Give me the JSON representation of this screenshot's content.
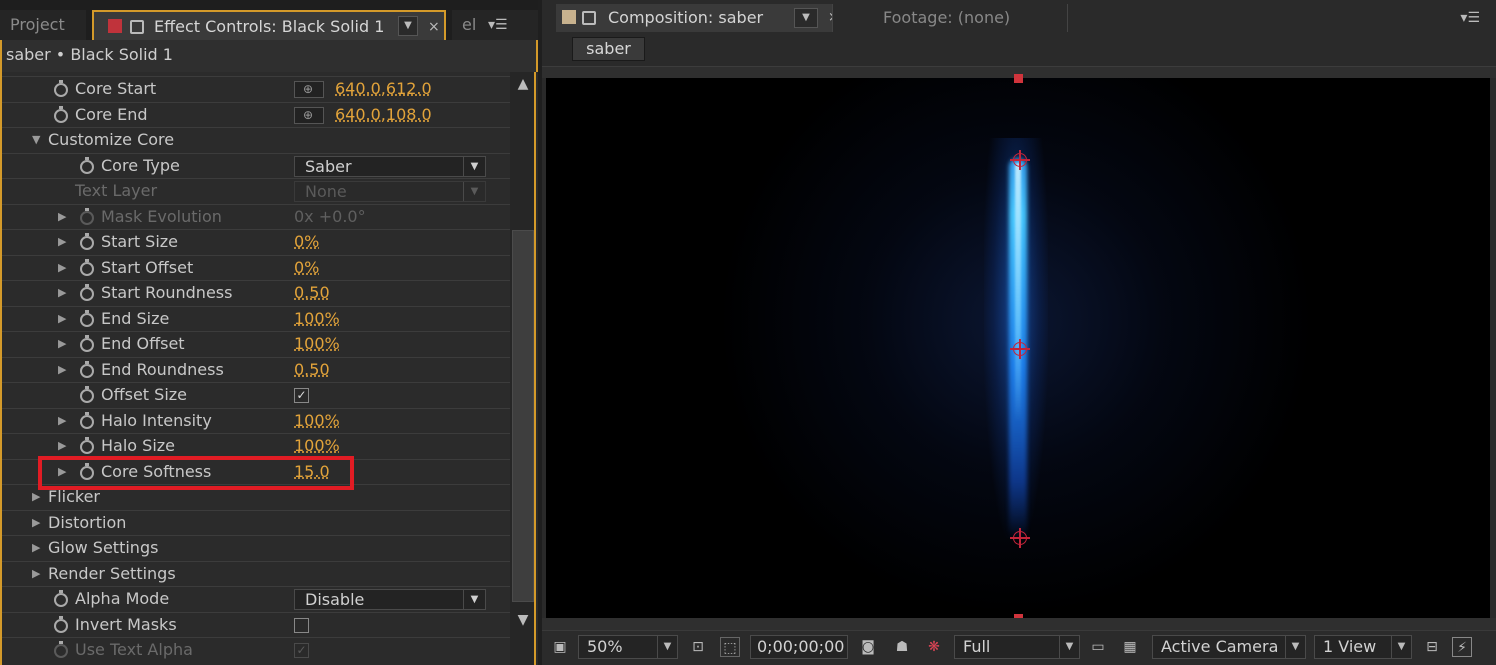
{
  "left_panel": {
    "tabs": {
      "project": "Project",
      "effect_controls": "Effect Controls: Black Solid 1",
      "el": "el"
    },
    "layer_path": "saber • Black Solid 1",
    "rows": [
      {
        "label": "Core Start",
        "value": "640.0,612.0"
      },
      {
        "label": "Core End",
        "value": "640.0,108.0"
      },
      {
        "label": "Customize Core"
      },
      {
        "label": "Core Type",
        "value": "Saber"
      },
      {
        "label": "Text Layer",
        "value": "None"
      },
      {
        "label": "Mask Evolution",
        "value": "0x +0.0°"
      },
      {
        "label": "Start Size",
        "value": "0%"
      },
      {
        "label": "Start Offset",
        "value": "0%"
      },
      {
        "label": "Start Roundness",
        "value": "0.50"
      },
      {
        "label": "End Size",
        "value": "100%"
      },
      {
        "label": "End Offset",
        "value": "100%"
      },
      {
        "label": "End Roundness",
        "value": "0.50"
      },
      {
        "label": "Offset Size",
        "value": "✓"
      },
      {
        "label": "Halo Intensity",
        "value": "100%"
      },
      {
        "label": "Halo Size",
        "value": "100%"
      },
      {
        "label": "Core Softness",
        "value": "15.0"
      },
      {
        "label": "Flicker"
      },
      {
        "label": "Distortion"
      },
      {
        "label": "Glow Settings"
      },
      {
        "label": "Render Settings"
      },
      {
        "label": "Alpha Mode",
        "value": "Disable"
      },
      {
        "label": "Invert Masks",
        "value": ""
      },
      {
        "label": "Use Text Alpha",
        "value": "✓"
      }
    ]
  },
  "right_panel": {
    "tabs": {
      "composition": "Composition: saber",
      "footage": "Footage: (none)"
    },
    "comp_button": "saber",
    "toolbar": {
      "zoom": "50%",
      "timecode": "0;00;00;00",
      "resolution": "Full",
      "camera": "Active Camera",
      "views": "1 View"
    }
  },
  "colors": {
    "accent_orange": "#d49a2a",
    "value_orange": "#e2a33a",
    "highlight_red": "#e11c24",
    "beam_blue": "#3aa8ff"
  }
}
